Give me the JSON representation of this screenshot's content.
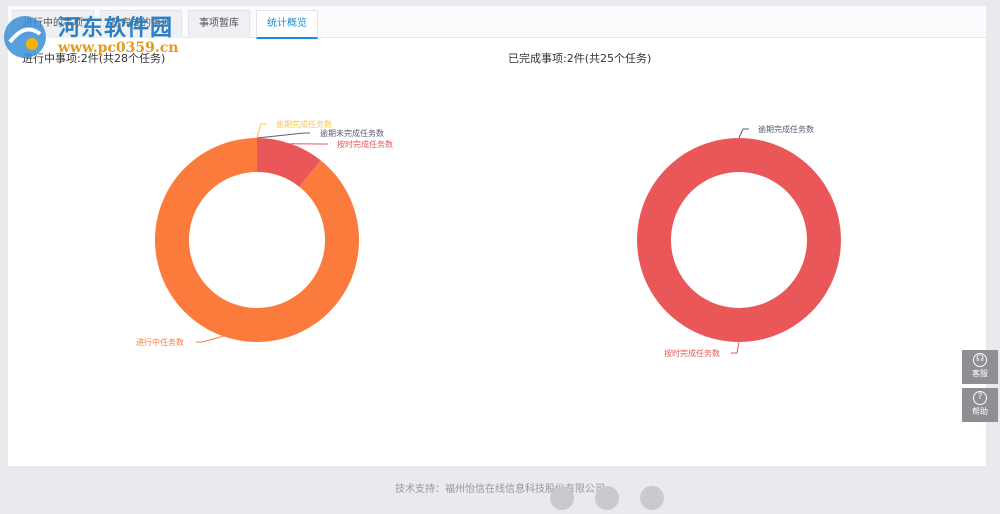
{
  "tabs": [
    {
      "label": "进行中的事项"
    },
    {
      "label": "已完成的事项"
    },
    {
      "label": "事项暂库"
    },
    {
      "label": "统计概览"
    }
  ],
  "watermark": {
    "name": "河东软件园",
    "url": "www.pc0359.cn"
  },
  "left_title": "进行中事项:2件(共28个任务)",
  "right_title": "已完成事项:2件(共25个任务)",
  "side": {
    "service": "客服",
    "help": "帮助"
  },
  "footer": {
    "text": "技术支持：福州怡信在线信息科技股份有限公司"
  },
  "colors": {
    "orange": "#fb7b3c",
    "red": "#ea5758",
    "yellow": "#f9c84a",
    "dark": "#5a5c78"
  },
  "chart_data": [
    {
      "type": "pie",
      "title": "进行中事项:2件(共28个任务)",
      "donut": true,
      "slices": [
        {
          "label": "逾期完成任务数",
          "value": 0,
          "color": "#f9c84a"
        },
        {
          "label": "逾期未完成任务数",
          "value": 0,
          "color": "#5a5c78"
        },
        {
          "label": "按时完成任务数",
          "value": 3,
          "color": "#ea5758"
        },
        {
          "label": "进行中任务数",
          "value": 25,
          "color": "#fb7b3c"
        }
      ]
    },
    {
      "type": "pie",
      "title": "已完成事项:2件(共25个任务)",
      "donut": true,
      "slices": [
        {
          "label": "逾期完成任务数",
          "value": 0,
          "color": "#5a5c78"
        },
        {
          "label": "按时完成任务数",
          "value": 25,
          "color": "#ea5758"
        }
      ]
    }
  ]
}
